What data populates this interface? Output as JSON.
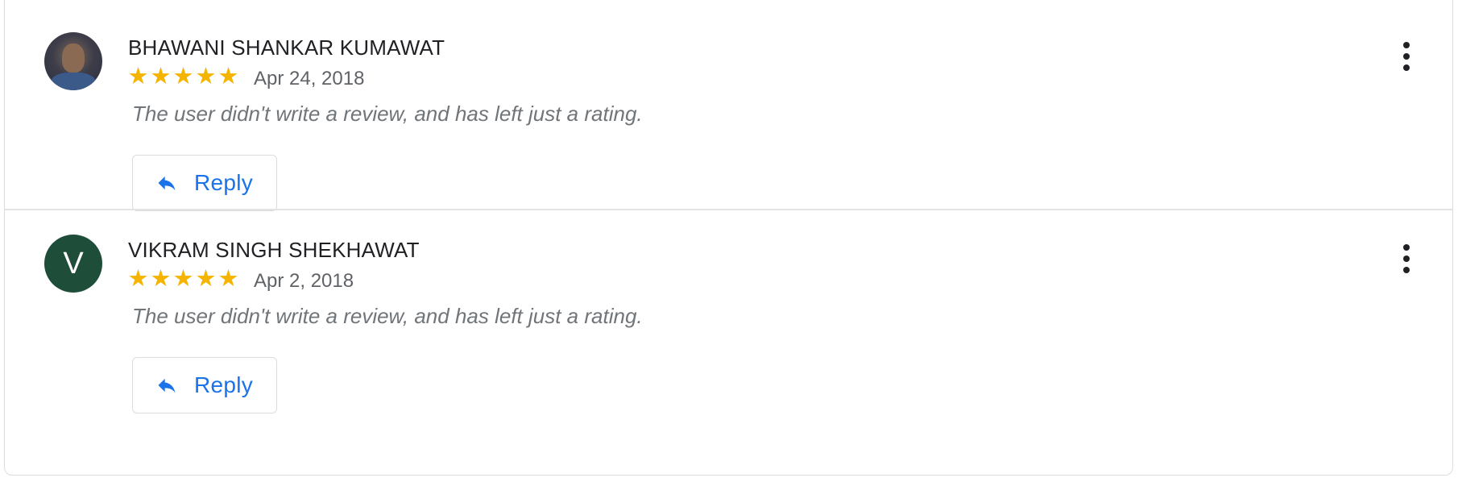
{
  "reviews": [
    {
      "author": "BHAWANI SHANKAR KUMAWAT",
      "avatar": {
        "type": "photo"
      },
      "rating": 5,
      "stars": [
        "★",
        "★",
        "★",
        "★",
        "★"
      ],
      "date": "Apr 24, 2018",
      "text": "The user didn't write a review, and has left just a rating.",
      "reply_label": "Reply",
      "more_icon": "more-vert-icon"
    },
    {
      "author": "VIKRAM SINGH SHEKHAWAT",
      "avatar": {
        "type": "letter",
        "letter": "V",
        "color": "#1e4d3a"
      },
      "rating": 5,
      "stars": [
        "★",
        "★",
        "★",
        "★",
        "★"
      ],
      "date": "Apr 2, 2018",
      "text": "The user didn't write a review, and has left just a rating.",
      "reply_label": "Reply",
      "more_icon": "more-vert-icon"
    }
  ],
  "colors": {
    "star": "#f4b400",
    "accent": "#1a73e8",
    "name": "#202124",
    "secondary": "#5f6368",
    "review_text": "#70757a",
    "border": "#dadce0"
  }
}
